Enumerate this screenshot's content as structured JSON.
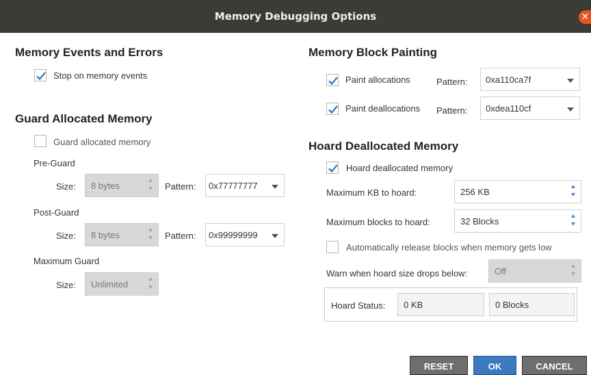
{
  "window": {
    "title": "Memory Debugging Options",
    "close_symbol": "×"
  },
  "events": {
    "heading": "Memory Events and Errors",
    "stop": {
      "label": "Stop on memory events",
      "checked": true
    }
  },
  "guard": {
    "heading": "Guard Allocated Memory",
    "enable": {
      "label": "Guard allocated memory",
      "checked": false
    },
    "pre": {
      "heading": "Pre-Guard",
      "size_label": "Size:",
      "size_value": "8 bytes",
      "pattern_label": "Pattern:",
      "pattern_value": "0x77777777"
    },
    "post": {
      "heading": "Post-Guard",
      "size_label": "Size:",
      "size_value": "8 bytes",
      "pattern_label": "Pattern:",
      "pattern_value": "0x99999999"
    },
    "max": {
      "heading": "Maximum Guard",
      "size_label": "Size:",
      "size_value": "Unlimited"
    }
  },
  "painting": {
    "heading": "Memory Block Painting",
    "alloc": {
      "label": "Paint allocations",
      "checked": true,
      "pattern_label": "Pattern:",
      "pattern_value": "0xa110ca7f"
    },
    "dealloc": {
      "label": "Paint deallocations",
      "checked": true,
      "pattern_label": "Pattern:",
      "pattern_value": "0xdea110cf"
    }
  },
  "hoard": {
    "heading": "Hoard Deallocated Memory",
    "enable": {
      "label": "Hoard deallocated memory",
      "checked": true
    },
    "max_kb": {
      "label": "Maximum KB to hoard:",
      "value": "256 KB"
    },
    "max_blocks": {
      "label": "Maximum blocks to hoard:",
      "value": "32 Blocks"
    },
    "auto_release": {
      "label": "Automatically release blocks when memory gets low",
      "checked": false
    },
    "warn": {
      "label": "Warn when hoard size drops below:",
      "value": "Off"
    },
    "status": {
      "label": "Hoard Status:",
      "kb": "0 KB",
      "blocks": "0 Blocks"
    }
  },
  "buttons": {
    "reset": "RESET",
    "ok": "OK",
    "cancel": "CANCEL"
  },
  "colors": {
    "accent": "#3c79c0",
    "titlebar": "#3b3b37",
    "close": "#e95420",
    "check": "#3c79c0"
  },
  "icons": {
    "check": "checkmark-icon",
    "close": "close-icon",
    "spin": "spinner-arrows-icon",
    "dropdown": "chevron-down-icon"
  }
}
